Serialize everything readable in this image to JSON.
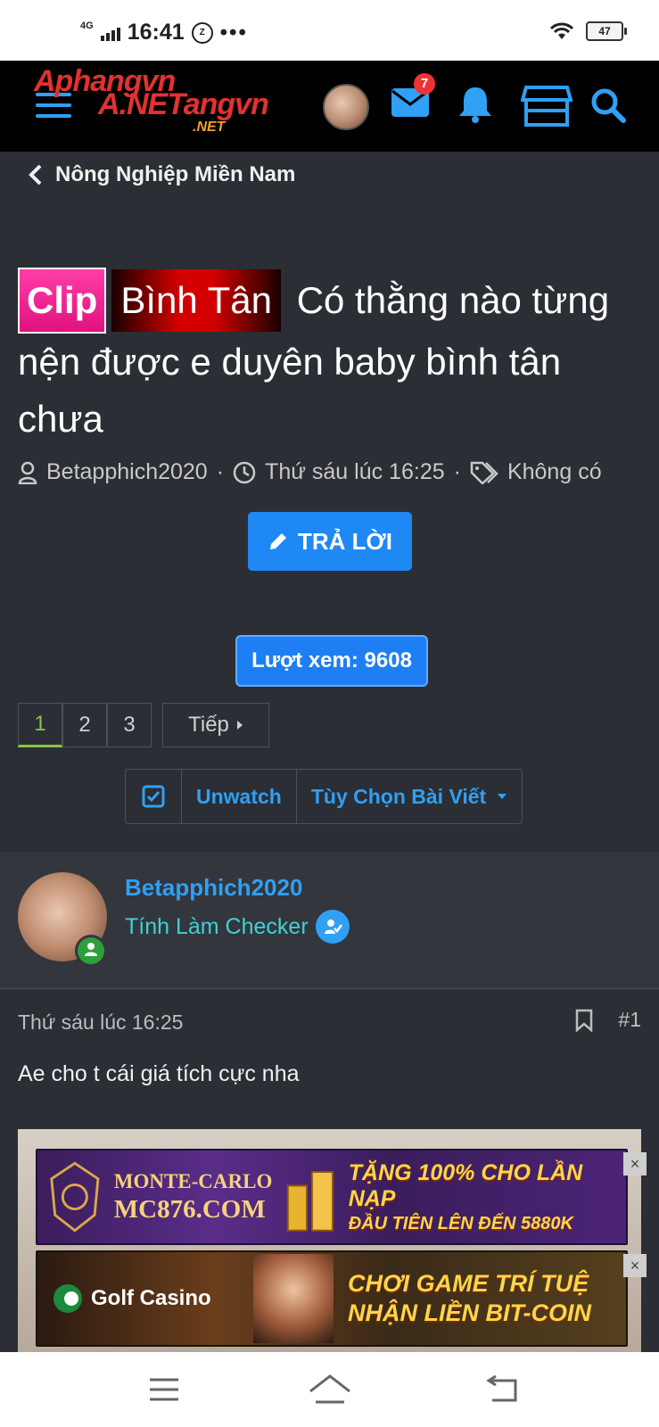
{
  "status_bar": {
    "network": "4G",
    "time": "16:41",
    "app_icon": "Zalo",
    "more": "•••",
    "battery": "47"
  },
  "top_nav": {
    "logo_line1": "Aphangvn",
    "logo_line2": "A.NETangvn",
    "logo_line3": ".NET",
    "mail_badge": "7"
  },
  "breadcrumb": {
    "label": "Nông Nghiệp Miền Nam"
  },
  "thread": {
    "label_clip": "Clip",
    "label_area": "Bình Tân",
    "title": "Có thằng nào từng nện được e duyên baby bình tân chưa",
    "author": "Betapphich2020",
    "time": "Thứ sáu lúc 16:25",
    "tags": "Không có",
    "reply_label": "TRẢ LỜI",
    "views": "Lượt xem: 9608"
  },
  "pager": {
    "pages": [
      "1",
      "2",
      "3"
    ],
    "next_label": "Tiếp"
  },
  "actions": {
    "unwatch": "Unwatch",
    "options": "Tùy Chọn Bài Viết"
  },
  "post": {
    "username": "Betapphich2020",
    "user_title": "Tính Làm Checker",
    "date": "Thứ sáu lúc 16:25",
    "number": "#1",
    "body": "Ae cho t cái giá tích cực nha"
  },
  "ads": {
    "ad1_brand_top": "MONTE-CARLO",
    "ad1_brand_bottom": "MC876.COM",
    "ad1_promo_top": "TẶNG 100% CHO LẦN NẠP",
    "ad1_promo_bottom": "ĐẦU TIÊN LÊN ĐẾN 5880K",
    "ad2_brand": "Golf Casino",
    "ad2_promo_top": "CHƠI GAME TRÍ TUỆ",
    "ad2_promo_bottom": "NHẬN LIỀN BIT-COIN",
    "close": "×"
  },
  "colors": {
    "accent": "#2fa0f4",
    "button": "#1e88f5",
    "active_page": "#8bc34a",
    "badge": "#e33333"
  }
}
